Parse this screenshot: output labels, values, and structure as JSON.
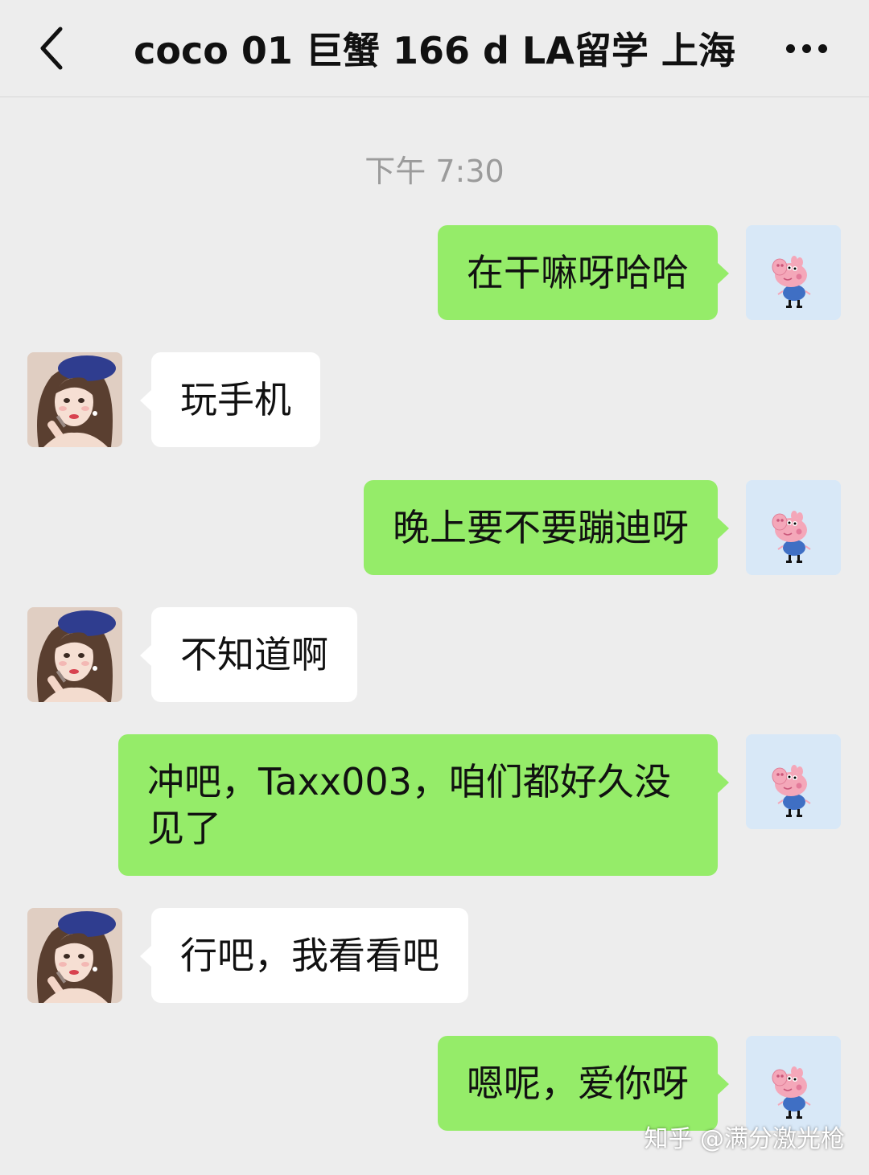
{
  "header": {
    "title": "coco 01 巨蟹 166 d LA留学 上海",
    "back_icon": "chevron-left-icon",
    "more_icon": "more-dots-icon"
  },
  "timestamp": "下午 7:30",
  "messages": [
    {
      "from": "me",
      "text": "在干嘛呀哈哈"
    },
    {
      "from": "her",
      "text": "玩手机"
    },
    {
      "from": "me",
      "text": "晚上要不要蹦迪呀"
    },
    {
      "from": "her",
      "text": "不知道啊"
    },
    {
      "from": "me",
      "text": "冲吧，Taxx003，咱们都好久没见了"
    },
    {
      "from": "her",
      "text": "行吧，我看看吧"
    },
    {
      "from": "me",
      "text": "嗯呢，爱你呀"
    }
  ],
  "watermark": "知乎 @满分激光枪",
  "colors": {
    "background": "#ededed",
    "my_bubble": "#95ec69",
    "her_bubble": "#ffffff",
    "timestamp": "#9b9b9b"
  }
}
